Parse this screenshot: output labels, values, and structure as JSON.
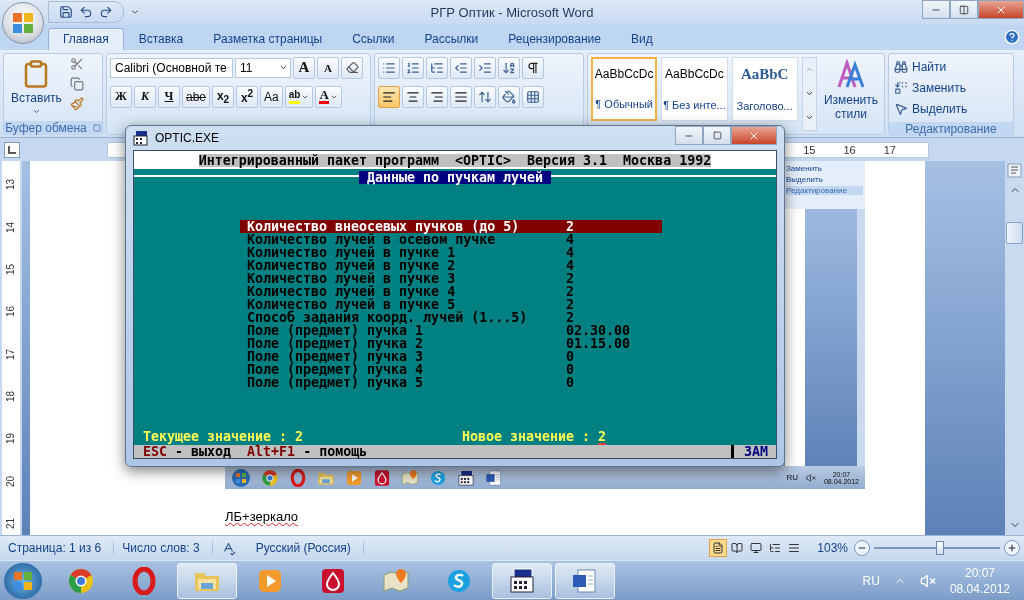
{
  "word": {
    "title": "РГР Оптик - Microsoft Word",
    "tabs": [
      {
        "label": "Главная",
        "selected": true
      },
      {
        "label": "Вставка",
        "selected": false
      },
      {
        "label": "Разметка страницы",
        "selected": false
      },
      {
        "label": "Ссылки",
        "selected": false
      },
      {
        "label": "Рассылки",
        "selected": false
      },
      {
        "label": "Рецензирование",
        "selected": false
      },
      {
        "label": "Вид",
        "selected": false
      }
    ],
    "clipboard": {
      "paste": "Вставить",
      "group": "Буфер обмена"
    },
    "font": {
      "name": "Calibri (Основной те",
      "size": "11",
      "grow": "A",
      "shrink": "A",
      "format_buttons": [
        {
          "label": "Ж",
          "kind": "bold"
        },
        {
          "label": "К",
          "kind": "italic"
        },
        {
          "label": "Ч",
          "kind": "underline"
        },
        {
          "label": "abe",
          "kind": "strike"
        },
        {
          "label": "x$_{2}$",
          "kind": "plain"
        },
        {
          "label": "x$^{2}$",
          "kind": "plain"
        },
        {
          "label": "Aa",
          "kind": "case"
        }
      ],
      "color_buttons": [
        {
          "label": "ab",
          "color": "#ffff00",
          "kind": "highlight"
        },
        {
          "label": "A",
          "color": "#ff0000",
          "kind": "font"
        }
      ]
    },
    "paragraph": {
      "alignments": [
        {
          "kind": "left",
          "selected": true
        },
        {
          "kind": "center",
          "selected": false
        },
        {
          "kind": "right",
          "selected": false
        },
        {
          "kind": "justify",
          "selected": false
        }
      ]
    },
    "styles": [
      {
        "preview": "AaBbCcDc",
        "label": "¶ Обычный",
        "selected": true,
        "kind": "normal"
      },
      {
        "preview": "AaBbCcDc",
        "label": "¶ Без инте...",
        "selected": false,
        "kind": "normal"
      },
      {
        "preview": "AaBbC",
        "label": "Заголово...",
        "selected": false,
        "kind": "heading"
      }
    ],
    "change_styles": "Изменить стили",
    "editing": {
      "items": [
        {
          "label": "Найти",
          "kind": "find"
        },
        {
          "label": "Заменить",
          "kind": "replace"
        },
        {
          "label": "Выделить",
          "kind": "select"
        }
      ],
      "group": "Редактирование"
    },
    "ruler": [
      "15",
      "16",
      "17"
    ],
    "vertical_ruler": [
      "13",
      "14",
      "15",
      "16",
      "17",
      "18",
      "19",
      "20",
      "21"
    ],
    "embedded": {
      "ribbon_items": [
        "Заменить",
        "Выделить"
      ],
      "group": "Редактирование",
      "apps": [
        {
          "kind": "globe"
        },
        {
          "kind": "ring"
        },
        {
          "kind": "folder"
        },
        {
          "kind": "player"
        },
        {
          "kind": "drop"
        },
        {
          "kind": "map"
        },
        {
          "kind": "chat"
        },
        {
          "kind": "console"
        },
        {
          "kind": "document"
        }
      ],
      "language": "RU",
      "time": "20:07",
      "date": "08.04.2012"
    },
    "document_text": "ЛБ+зеркало",
    "status": {
      "page": "Страница: 1 из 6",
      "words": "Число слов: 3",
      "language": "Русский (Россия)",
      "views": [
        {
          "selected": true
        },
        {
          "selected": false
        },
        {
          "selected": false
        },
        {
          "selected": false
        },
        {
          "selected": false
        }
      ],
      "zoom": "103%",
      "zoom_level": {
        "level": 0.52
      }
    }
  },
  "optic": {
    "title": "OPTIC.EXE",
    "header": "Интегрированный пакет программ  <OPTIC>  Версия 3.1  Москва 1992",
    "screen_title": "Данные по пучкам лучей",
    "rows": [
      {
        "label": "Количество внеосевых пучков (до 5)",
        "value": "2",
        "selected": true
      },
      {
        "label": "Количество лучей в осевом пучке",
        "value": "4",
        "selected": false
      },
      {
        "label": "Количество лучей в пучке 1",
        "value": "4",
        "selected": false
      },
      {
        "label": "Количество лучей в пучке 2",
        "value": "4",
        "selected": false
      },
      {
        "label": "Количество лучей в пучке 3",
        "value": "2",
        "selected": false
      },
      {
        "label": "Количество лучей в пучке 4",
        "value": "2",
        "selected": false
      },
      {
        "label": "Количество лучей в пучке 5",
        "value": "2",
        "selected": false
      },
      {
        "label": "Способ задания коорд. лучей (1...5)",
        "value": "2",
        "selected": false
      },
      {
        "label": "Поле (предмет) пучка 1",
        "value": "02.30.00",
        "selected": false
      },
      {
        "label": "Поле (предмет) пучка 2",
        "value": "01.15.00",
        "selected": false
      },
      {
        "label": "Поле (предмет) пучка 3",
        "value": "0",
        "selected": false
      },
      {
        "label": "Поле (предмет) пучка 4",
        "value": "0",
        "selected": false
      },
      {
        "label": "Поле (предмет) пучка 5",
        "value": "0",
        "selected": false
      }
    ],
    "current": "Текущее значение : 2",
    "new_label": "Новое значение :",
    "new_value": "2",
    "hints": [
      {
        "key": "ESC",
        "action": "- выход"
      },
      {
        "key": "Alt+F1",
        "action": "- помощь"
      }
    ],
    "mode": "ЗАМ"
  },
  "taskbar": {
    "apps": [
      {
        "kind": "globe",
        "active": false
      },
      {
        "kind": "ring",
        "active": false
      },
      {
        "kind": "folder",
        "active": true
      },
      {
        "kind": "player",
        "active": false
      },
      {
        "kind": "drop",
        "active": false
      },
      {
        "kind": "map",
        "active": false
      },
      {
        "kind": "chat",
        "active": false
      },
      {
        "kind": "console",
        "active": true
      },
      {
        "kind": "document",
        "active": true
      }
    ],
    "language": "RU",
    "time": "20:07",
    "date": "08.04.2012"
  }
}
